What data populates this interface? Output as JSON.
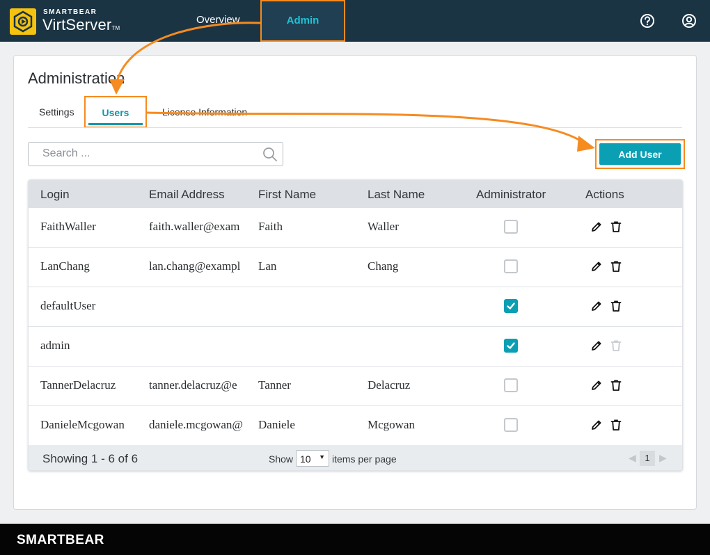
{
  "header": {
    "brand_small": "SMARTBEAR",
    "brand_big": "VirtServer",
    "brand_tm": "TM",
    "nav": [
      {
        "label": "Overview"
      },
      {
        "label": "Admin"
      }
    ],
    "help_icon": "help-circle-icon",
    "user_icon": "user-circle-icon"
  },
  "page": {
    "title": "Administration",
    "tabs": [
      {
        "label": "Settings"
      },
      {
        "label": "Users"
      },
      {
        "label": "License Information"
      }
    ],
    "active_tab": "Users"
  },
  "search": {
    "value": "",
    "placeholder": "Search ..."
  },
  "add_user_label": "Add User",
  "table": {
    "columns": [
      "Login",
      "Email Address",
      "First Name",
      "Last Name",
      "Administrator",
      "Actions"
    ],
    "rows": [
      {
        "login": "FaithWaller",
        "email": "faith.waller@exam",
        "first": "Faith",
        "last": "Waller",
        "admin": false
      },
      {
        "login": "LanChang",
        "email": "lan.chang@exampl",
        "first": "Lan",
        "last": "Chang",
        "admin": false
      },
      {
        "login": "defaultUser",
        "email": "",
        "first": "",
        "last": "",
        "admin": true
      },
      {
        "login": "admin",
        "email": "",
        "first": "",
        "last": "",
        "admin": true,
        "delete_disabled": true
      },
      {
        "login": "TannerDelacruz",
        "email": "tanner.delacruz@e",
        "first": "Tanner",
        "last": "Delacruz",
        "admin": false
      },
      {
        "login": "DanieleMcgowan",
        "email": "daniele.mcgowan@",
        "first": "Daniele",
        "last": "Mcgowan",
        "admin": false
      }
    ],
    "action_icons": [
      "pencil-icon",
      "trash-icon"
    ]
  },
  "pager": {
    "showing": "Showing 1 - 6 of 6",
    "show_label": "Show",
    "per_page": "10",
    "per_page_suffix": "items per page",
    "current_page": "1"
  },
  "footer": {
    "brand": "SMARTBEAR"
  },
  "colors": {
    "topbar": "#1b3444",
    "accent": "#0b9fb4",
    "highlight": "#f68b1f",
    "logo": "#f4c20f"
  }
}
